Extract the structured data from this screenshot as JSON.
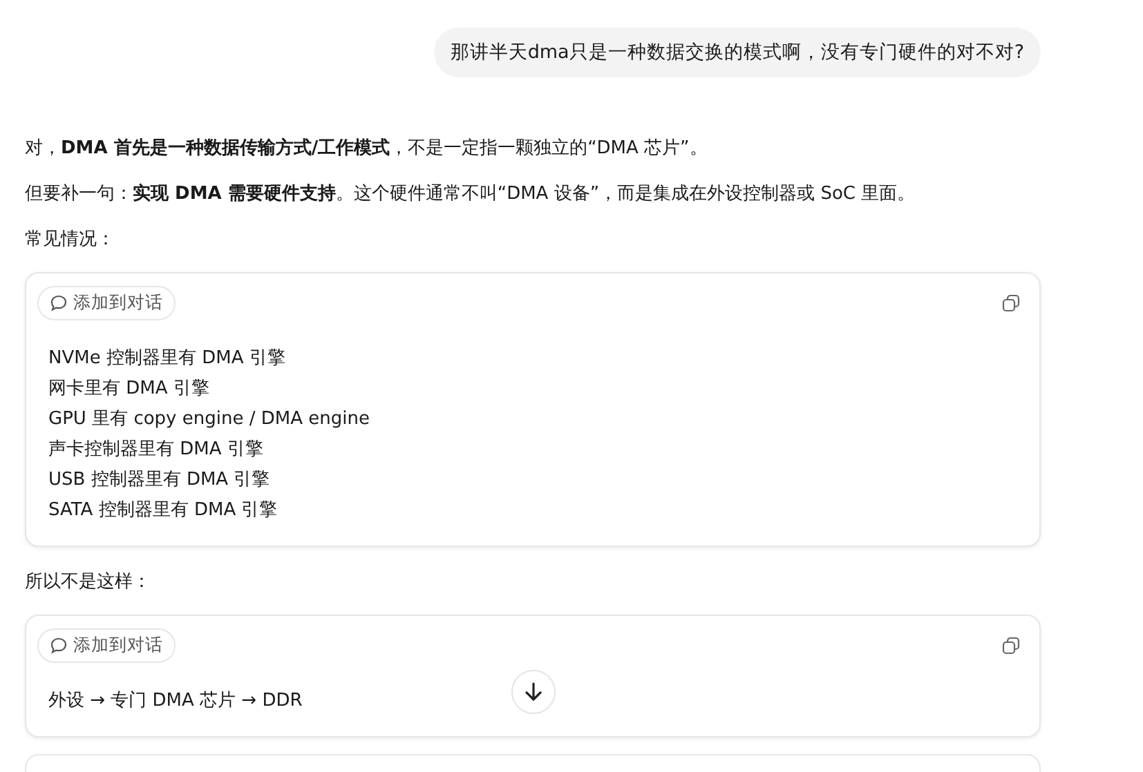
{
  "user_message": "那讲半天dma只是一种数据交换的模式啊，没有专门硬件的对不对?",
  "answer": {
    "paragraphs": [
      "对，**DMA 首先是一种数据传输方式/工作模式**，不是一定指一颗独立的“DMA 芯片”。",
      "但要补一句：**实现 DMA 需要硬件支持**。这个硬件通常不叫“DMA 设备”，而是集成在外设控制器或 SoC 里面。",
      "常见情况："
    ],
    "blocks": [
      {
        "add_button": "添加到对话",
        "lines": [
          "NVMe 控制器里有 DMA 引擎",
          "网卡里有 DMA 引擎",
          "GPU 里有 copy engine / DMA engine",
          "声卡控制器里有 DMA 引擎",
          "USB 控制器里有 DMA 引擎",
          "SATA 控制器里有 DMA 引擎"
        ]
      }
    ],
    "after_text": "所以不是这样：",
    "blocks_2": [
      {
        "add_button": "添加到对话",
        "lines": [
          "外设 → 专门 DMA 芯片 → DDR"
        ]
      }
    ]
  }
}
